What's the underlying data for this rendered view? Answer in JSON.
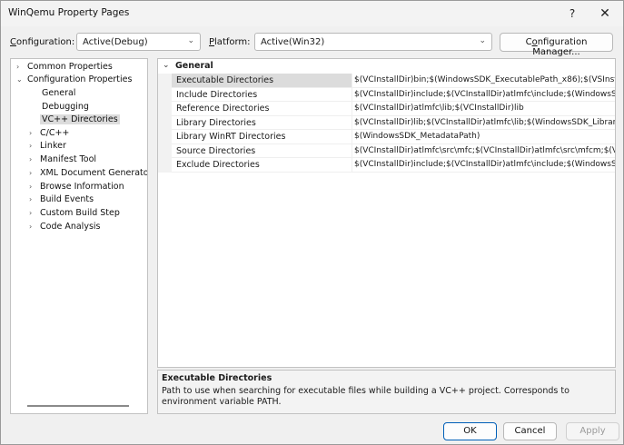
{
  "window": {
    "title": "WinQemu Property Pages",
    "help_label": "?",
    "close_label": "✕"
  },
  "config_bar": {
    "configuration_label_u": "C",
    "configuration_label_rest": "onfiguration:",
    "configuration_value": "Active(Debug)",
    "platform_label_u": "P",
    "platform_label_rest": "latform:",
    "platform_value": "Active(Win32)",
    "manager_pre": "C",
    "manager_u": "o",
    "manager_rest": "nfiguration Manager..."
  },
  "tree": {
    "items": [
      {
        "label": "Common Properties",
        "chevron": "›"
      },
      {
        "label": "Configuration Properties",
        "chevron": "⌄"
      },
      {
        "label": "General",
        "chevron": ""
      },
      {
        "label": "Debugging",
        "chevron": ""
      },
      {
        "label": "VC++ Directories",
        "chevron": "",
        "selected": true
      },
      {
        "label": "C/C++",
        "chevron": "›"
      },
      {
        "label": "Linker",
        "chevron": "›"
      },
      {
        "label": "Manifest Tool",
        "chevron": "›"
      },
      {
        "label": "XML Document Generator",
        "chevron": "›"
      },
      {
        "label": "Browse Information",
        "chevron": "›"
      },
      {
        "label": "Build Events",
        "chevron": "›"
      },
      {
        "label": "Custom Build Step",
        "chevron": "›"
      },
      {
        "label": "Code Analysis",
        "chevron": "›"
      }
    ]
  },
  "grid": {
    "category": "General",
    "category_chevron": "⌄",
    "rows": [
      {
        "name": "Executable Directories",
        "value": "$(VCInstallDir)bin;$(WindowsSDK_ExecutablePath_x86);$(VSInstallDi"
      },
      {
        "name": "Include Directories",
        "value": "$(VCInstallDir)include;$(VCInstallDir)atlmfc\\include;$(WindowsSDK_"
      },
      {
        "name": "Reference Directories",
        "value": "$(VCInstallDir)atlmfc\\lib;$(VCInstallDir)lib"
      },
      {
        "name": "Library Directories",
        "value": "$(VCInstallDir)lib;$(VCInstallDir)atlmfc\\lib;$(WindowsSDK_LibraryPa"
      },
      {
        "name": "Library WinRT Directories",
        "value": "$(WindowsSDK_MetadataPath)"
      },
      {
        "name": "Source Directories",
        "value": "$(VCInstallDir)atlmfc\\src\\mfc;$(VCInstallDir)atlmfc\\src\\mfcm;$(VCI"
      },
      {
        "name": "Exclude Directories",
        "value": "$(VCInstallDir)include;$(VCInstallDir)atlmfc\\include;$(WindowsSDK_"
      }
    ]
  },
  "description": {
    "title": "Executable Directories",
    "text": "Path to use when searching for executable files while building a VC++ project.  Corresponds to environment variable PATH."
  },
  "buttons": {
    "ok": "OK",
    "cancel": "Cancel",
    "apply": "Apply"
  }
}
